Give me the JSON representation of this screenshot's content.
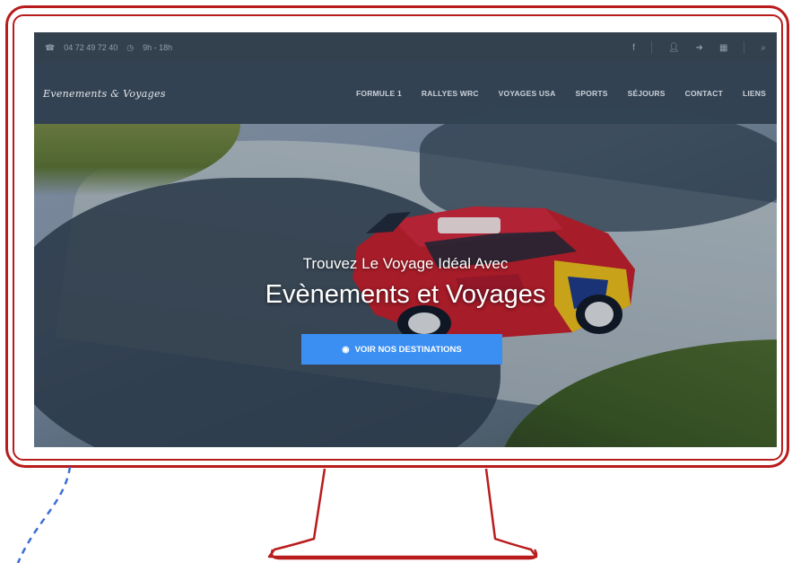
{
  "topbar": {
    "phone": "04 72 49 72 40",
    "hours": "9h - 18h",
    "icons": [
      "facebook-icon",
      "user-icon",
      "login-icon",
      "cart-icon",
      "search-icon"
    ]
  },
  "brand": {
    "logo": "Evenements & Voyages"
  },
  "menu": {
    "items": [
      {
        "label": "FORMULE 1"
      },
      {
        "label": "RALLYES WRC"
      },
      {
        "label": "VOYAGES USA"
      },
      {
        "label": "SPORTS"
      },
      {
        "label": "SÉJOURS"
      },
      {
        "label": "CONTACT"
      },
      {
        "label": "LIENS"
      }
    ]
  },
  "hero": {
    "subtitle": "Trouvez Le Voyage Idéal Avec",
    "title": "Evènements et Voyages",
    "cta": "VOIR NOS DESTINATIONS"
  },
  "colors": {
    "frame": "#b91c1c",
    "dash": "#3b6fd6",
    "nav_bg": "#334252",
    "cta_bg": "#3b8ff2"
  }
}
